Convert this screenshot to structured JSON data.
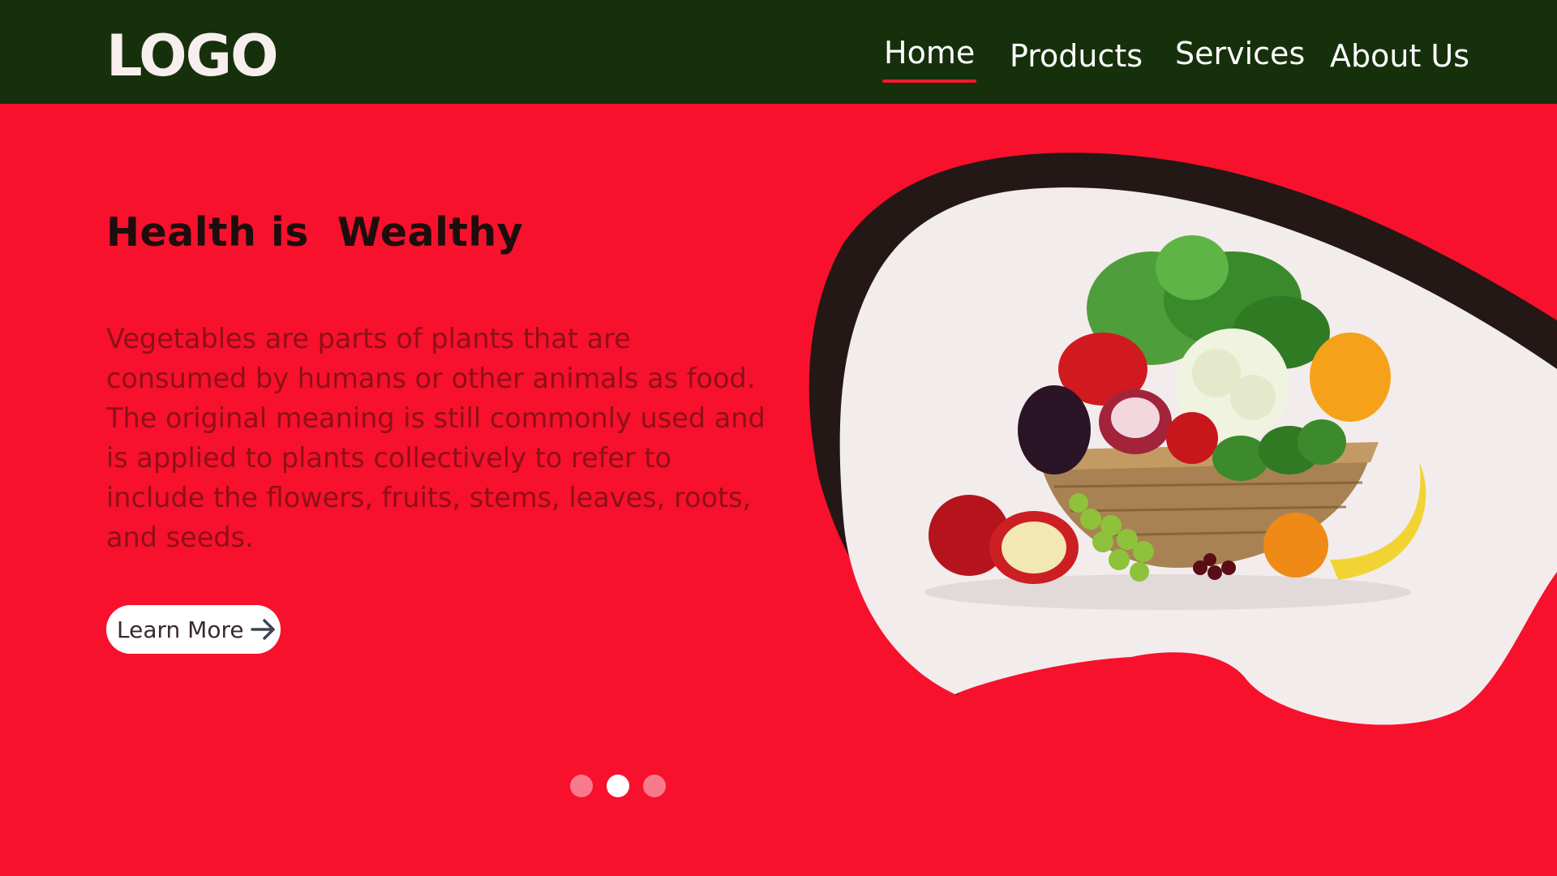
{
  "header": {
    "logo": "LOGO",
    "nav": [
      {
        "label": "Home",
        "active": true
      },
      {
        "label": "Products",
        "active": false
      },
      {
        "label": "Services",
        "active": false
      },
      {
        "label": "About Us",
        "active": false
      }
    ]
  },
  "hero": {
    "title": "Health is  Wealthy",
    "description": "Vegetables are parts of plants that are consumed by humans or other animals as food. The original meaning is still commonly used and is applied to plants collectively to refer to include the flowers, fruits, stems, leaves, roots, and seeds.",
    "cta_label": "Learn More",
    "cta_icon": "arrow-right-icon",
    "image_icon": "vegetable-basket-image"
  },
  "carousel": {
    "slide_count": 3,
    "active_index": 1
  },
  "colors": {
    "header_bg": "#17300c",
    "hero_bg": "#f7112c",
    "title_text": "#1d0d0d",
    "description_text": "#8e1018",
    "active_underline": "#ef1a2e",
    "blob_shadow": "#231816",
    "blob_fill": "#f3ecec",
    "dot_inactive": "#f77b8d",
    "dot_active": "#ffffff"
  }
}
